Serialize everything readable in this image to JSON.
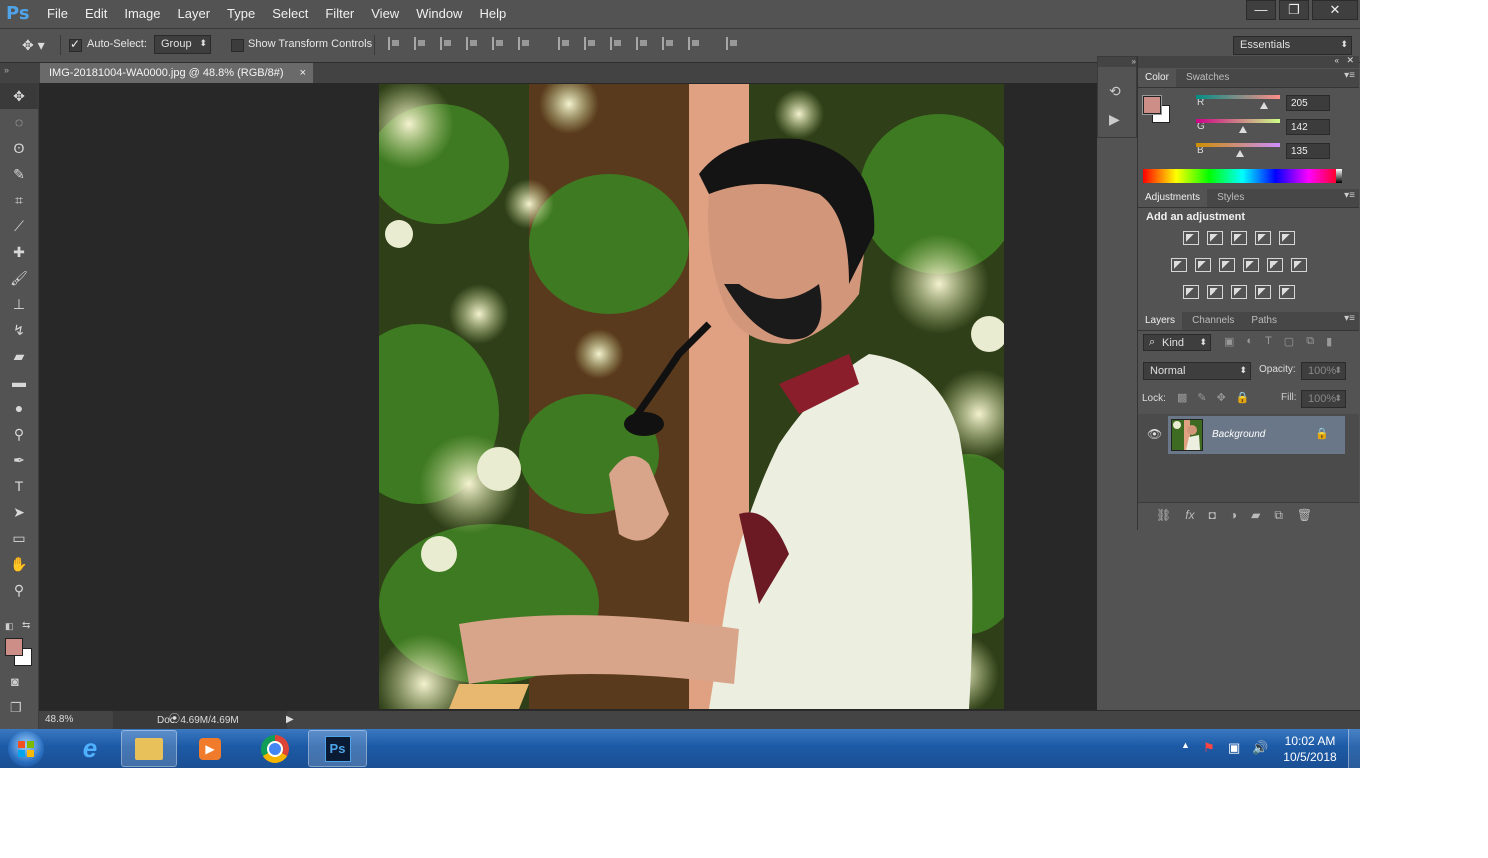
{
  "app": {
    "logo": "Ps"
  },
  "menu": [
    "File",
    "Edit",
    "Image",
    "Layer",
    "Type",
    "Select",
    "Filter",
    "View",
    "Window",
    "Help"
  ],
  "window_buttons": {
    "minimize": "—",
    "restore": "❐",
    "close": "✕"
  },
  "options": {
    "auto_select_label": "Auto-Select:",
    "auto_select_checked": true,
    "auto_select_target": "Group",
    "transform_label": "Show Transform Controls",
    "transform_checked": false,
    "workspace": "Essentials"
  },
  "document": {
    "tab_title": "IMG-20181004-WA0000.jpg @ 48.8% (RGB/8#)",
    "close": "×"
  },
  "status": {
    "zoom": "48.8%",
    "doc": "Doc: 4.69M/4.69M"
  },
  "color_panel": {
    "tabs": [
      "Color",
      "Swatches"
    ],
    "channels": [
      {
        "label": "R",
        "value": "205"
      },
      {
        "label": "G",
        "value": "142"
      },
      {
        "label": "B",
        "value": "135"
      }
    ],
    "foreground": "#cd8e87",
    "background": "#ffffff"
  },
  "adjustments_panel": {
    "tabs": [
      "Adjustments",
      "Styles"
    ],
    "heading": "Add an adjustment"
  },
  "layers_panel": {
    "tabs": [
      "Layers",
      "Channels",
      "Paths"
    ],
    "filter": "Kind",
    "blend_mode": "Normal",
    "opacity_label": "Opacity:",
    "opacity": "100%",
    "lock_label": "Lock:",
    "fill_label": "Fill:",
    "fill": "100%",
    "layers": [
      {
        "name": "Background",
        "visible": true,
        "locked": true
      }
    ]
  },
  "taskbar": {
    "time": "10:02 AM",
    "date": "10/5/2018",
    "apps": [
      "windows-start",
      "internet-explorer",
      "file-explorer",
      "media-player",
      "chrome",
      "photoshop"
    ]
  }
}
